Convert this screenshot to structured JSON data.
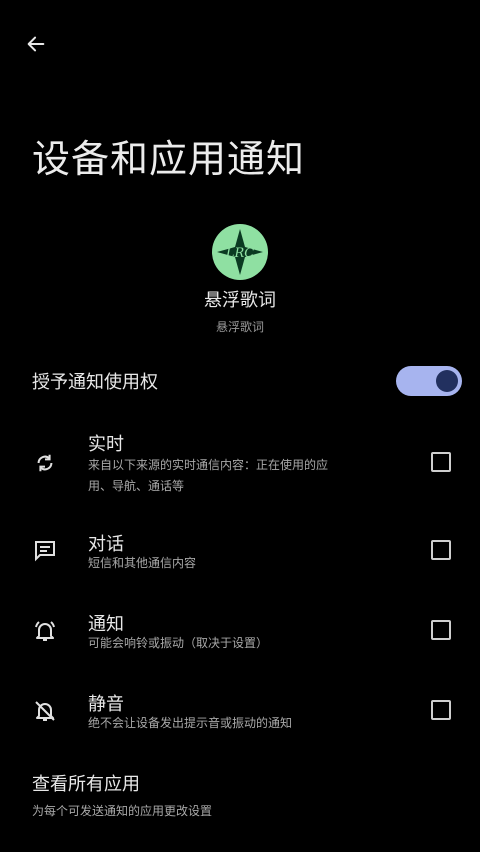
{
  "header": {
    "back_icon": "arrow-left-icon",
    "title": "设备和应用通知"
  },
  "app": {
    "icon": "lrc-app-icon",
    "icon_text": "LRC",
    "name": "悬浮歌词",
    "package": "悬浮歌词"
  },
  "grant": {
    "label": "授予通知使用权",
    "enabled": true
  },
  "options": [
    {
      "icon": "sync-icon",
      "title": "实时",
      "desc_line1": "来自以下来源的实时通信内容：正在使用的应",
      "desc_line2": "用、导航、通话等",
      "checked": false
    },
    {
      "icon": "message-icon",
      "title": "对话",
      "desc_line1": "短信和其他通信内容",
      "checked": false
    },
    {
      "icon": "bell-ringing-icon",
      "title": "通知",
      "desc_line1": "可能会响铃或振动（取决于设置）",
      "checked": false
    },
    {
      "icon": "bell-off-icon",
      "title": "静音",
      "desc_line1": "绝不会让设备发出提示音或振动的通知",
      "checked": false
    }
  ],
  "all_apps": {
    "title": "查看所有应用",
    "desc": "为每个可发送通知的应用更改设置"
  },
  "colors": {
    "background": "#000000",
    "toggle_track": "#a7b4ef",
    "toggle_knob": "#22305f",
    "app_icon_bg": "#8fe0a2"
  }
}
